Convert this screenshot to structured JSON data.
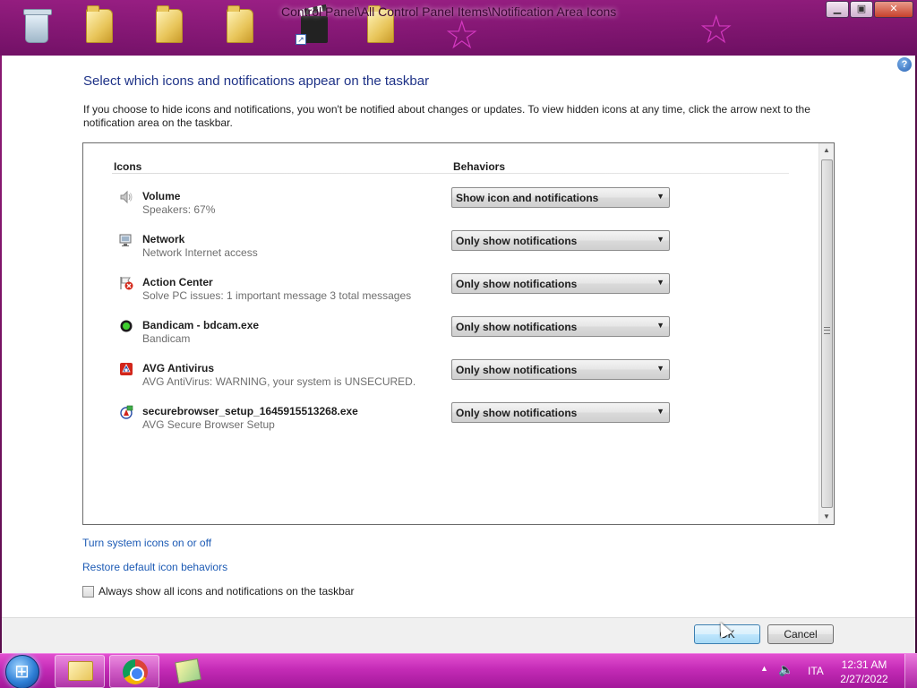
{
  "window": {
    "title": "Control Panel\\All Control Panel Items\\Notification Area Icons",
    "help_icon": "?"
  },
  "page": {
    "heading": "Select which icons and notifications appear on the taskbar",
    "intro": "If you choose to hide icons and notifications, you won't be notified about changes or updates. To view hidden icons at any time, click the arrow next to the notification area on the taskbar."
  },
  "list": {
    "col_icons": "Icons",
    "col_behaviors": "Behaviors",
    "rows": [
      {
        "name": "Volume",
        "desc": "Speakers: 67%",
        "icon": "speaker-icon",
        "behavior": "Show icon and notifications"
      },
      {
        "name": "Network",
        "desc": "Network  Internet access",
        "icon": "network-icon",
        "behavior": "Only show notifications"
      },
      {
        "name": "Action Center",
        "desc": "Solve PC issues: 1 important message  3 total messages",
        "icon": "action-center-flag-icon",
        "behavior": "Only show notifications"
      },
      {
        "name": "Bandicam - bdcam.exe",
        "desc": "Bandicam",
        "icon": "bandicam-record-icon",
        "behavior": "Only show notifications"
      },
      {
        "name": "AVG Antivirus",
        "desc": "AVG AntiVirus: WARNING, your system is UNSECURED.",
        "icon": "avg-antivirus-icon",
        "behavior": "Only show notifications"
      },
      {
        "name": "securebrowser_setup_1645915513268.exe",
        "desc": "AVG Secure Browser Setup",
        "icon": "avg-secure-browser-icon",
        "behavior": "Only show notifications"
      }
    ]
  },
  "links": {
    "turn_system_icons": "Turn system icons on or off",
    "restore_defaults": "Restore default icon behaviors"
  },
  "checkbox": {
    "label": "Always show all icons and notifications on the taskbar",
    "checked": false
  },
  "buttons": {
    "ok": "OK",
    "cancel": "Cancel"
  },
  "taskbar": {
    "language": "ITA",
    "time": "12:31 AM",
    "date": "2/27/2022"
  },
  "colors": {
    "heading": "#1e3287",
    "link": "#1d5bb5",
    "taskbar": "#c42bb6"
  }
}
